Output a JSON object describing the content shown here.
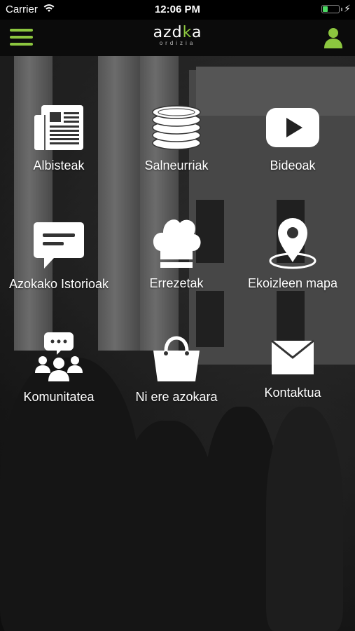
{
  "status_bar": {
    "carrier": "Carrier",
    "time": "12:06 PM",
    "battery_level": 0.35,
    "battery_color": "#4cd964"
  },
  "nav_bar": {
    "logo_text_a": "azd",
    "logo_text_b": "k",
    "logo_text_c": "a",
    "logo_subtitle": "ordizia",
    "accent_color": "#8cc63f",
    "menu_icon": "hamburger-icon",
    "user_icon": "user-icon"
  },
  "menu": {
    "items": [
      {
        "label": "Albisteak",
        "icon": "newspaper-icon"
      },
      {
        "label": "Salneurriak",
        "icon": "coins-icon"
      },
      {
        "label": "Bideoak",
        "icon": "play-video-icon"
      },
      {
        "label": "Azokako Istorioak",
        "icon": "speech-bubble-icon"
      },
      {
        "label": "Errezetak",
        "icon": "chef-hat-icon"
      },
      {
        "label": "Ekoizleen mapa",
        "icon": "map-pin-icon"
      },
      {
        "label": "Komunitatea",
        "icon": "community-icon"
      },
      {
        "label": "Ni ere azokara",
        "icon": "shopping-bag-icon"
      },
      {
        "label": "Kontaktua",
        "icon": "envelope-icon"
      }
    ]
  }
}
